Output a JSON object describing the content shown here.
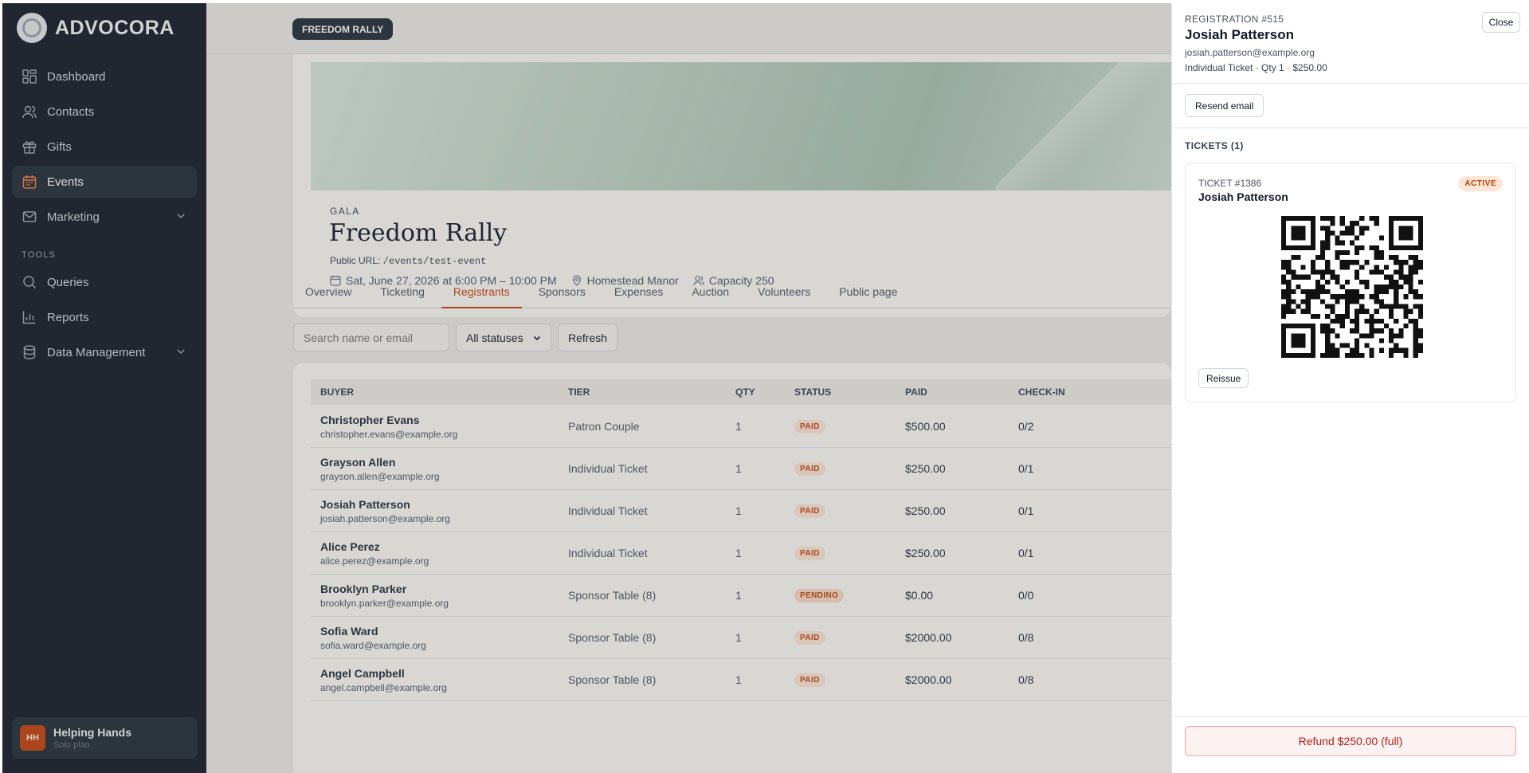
{
  "brand": {
    "name": "ADVOCORA"
  },
  "sidebar": {
    "items": [
      {
        "label": "Dashboard",
        "icon": "dashboard-icon"
      },
      {
        "label": "Contacts",
        "icon": "contacts-icon"
      },
      {
        "label": "Gifts",
        "icon": "gift-icon"
      },
      {
        "label": "Events",
        "icon": "calendar-icon",
        "active": true
      },
      {
        "label": "Marketing",
        "icon": "mail-icon",
        "expandable": true
      }
    ],
    "tools_label": "TOOLS",
    "tools": [
      {
        "label": "Queries",
        "icon": "search-icon"
      },
      {
        "label": "Reports",
        "icon": "bar-chart-icon"
      },
      {
        "label": "Data Management",
        "icon": "database-icon",
        "expandable": true
      }
    ]
  },
  "workspace": {
    "initials": "HH",
    "name": "Helping Hands",
    "plan": "Solo plan"
  },
  "event": {
    "pill": "FREEDOM RALLY",
    "type": "GALA",
    "title": "Freedom Rally",
    "url_label": "Public URL:",
    "url": "/events/test-event",
    "date": "Sat, June 27, 2026 at 6:00 PM – 10:00 PM",
    "venue": "Homestead Manor",
    "capacity": "Capacity 250"
  },
  "tabs": [
    "Overview",
    "Ticketing",
    "Registrants",
    "Sponsors",
    "Expenses",
    "Auction",
    "Volunteers",
    "Public page"
  ],
  "active_tab": "Registrants",
  "filters": {
    "search_placeholder": "Search name or email",
    "status": "All statuses",
    "refresh": "Refresh"
  },
  "table": {
    "headers": {
      "buyer": "BUYER",
      "tier": "TIER",
      "qty": "QTY",
      "status": "STATUS",
      "paid": "PAID",
      "checkin": "CHECK-IN"
    },
    "rows": [
      {
        "name": "Christopher Evans",
        "email": "christopher.evans@example.org",
        "tier": "Patron Couple",
        "qty": "1",
        "status": "PAID",
        "paid": "$500.00",
        "checkin": "0/2"
      },
      {
        "name": "Grayson Allen",
        "email": "grayson.allen@example.org",
        "tier": "Individual Ticket",
        "qty": "1",
        "status": "PAID",
        "paid": "$250.00",
        "checkin": "0/1"
      },
      {
        "name": "Josiah Patterson",
        "email": "josiah.patterson@example.org",
        "tier": "Individual Ticket",
        "qty": "1",
        "status": "PAID",
        "paid": "$250.00",
        "checkin": "0/1"
      },
      {
        "name": "Alice Perez",
        "email": "alice.perez@example.org",
        "tier": "Individual Ticket",
        "qty": "1",
        "status": "PAID",
        "paid": "$250.00",
        "checkin": "0/1"
      },
      {
        "name": "Brooklyn Parker",
        "email": "brooklyn.parker@example.org",
        "tier": "Sponsor Table (8)",
        "qty": "1",
        "status": "PENDING",
        "paid": "$0.00",
        "checkin": "0/0"
      },
      {
        "name": "Sofia Ward",
        "email": "sofia.ward@example.org",
        "tier": "Sponsor Table (8)",
        "qty": "1",
        "status": "PAID",
        "paid": "$2000.00",
        "checkin": "0/8"
      },
      {
        "name": "Angel Campbell",
        "email": "angel.campbell@example.org",
        "tier": "Sponsor Table (8)",
        "qty": "1",
        "status": "PAID",
        "paid": "$2000.00",
        "checkin": "0/8"
      }
    ]
  },
  "drawer": {
    "registration": "REGISTRATION #515",
    "name": "Josiah Patterson",
    "email": "josiah.patterson@example.org",
    "summary": "Individual Ticket · Qty 1 · $250.00",
    "close": "Close",
    "resend": "Resend email",
    "tickets_label": "TICKETS (1)",
    "ticket": {
      "id": "TICKET #1386",
      "name": "Josiah Patterson",
      "status": "ACTIVE",
      "reissue": "Reissue"
    },
    "refund": "Refund $250.00 (full)"
  },
  "colors": {
    "accent": "#c2410c",
    "sidebar": "#111827",
    "danger": "#b91c1c"
  }
}
